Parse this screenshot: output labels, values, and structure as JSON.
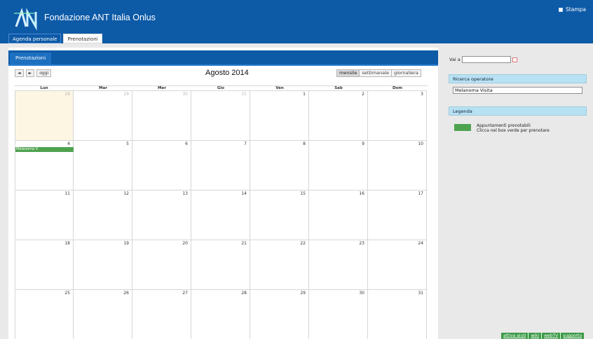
{
  "app": {
    "title": "Fondazione ANT Italia Onlus",
    "print_label": "Stampa",
    "logo_label": "ANT"
  },
  "top_tabs": [
    {
      "label": "Agenda personale"
    },
    {
      "label": "Prenotazioni"
    }
  ],
  "section": {
    "tab_label": "Prenotazioni"
  },
  "calendar": {
    "prev_label": "◄",
    "next_label": "►",
    "today_label": "oggi",
    "month_title": "Agosto 2014",
    "views": [
      "mensile",
      "settimanale",
      "giornaliera"
    ],
    "current_view": "mensile",
    "day_headers": [
      "Lun",
      "Mar",
      "Mer",
      "Gio",
      "Ven",
      "Sab",
      "Dom"
    ],
    "weeks": [
      [
        "28",
        "29",
        "30",
        "31",
        "1",
        "2",
        "3"
      ],
      [
        "4",
        "5",
        "6",
        "7",
        "8",
        "9",
        "10"
      ],
      [
        "11",
        "12",
        "13",
        "14",
        "15",
        "16",
        "17"
      ],
      [
        "18",
        "19",
        "20",
        "21",
        "22",
        "23",
        "24"
      ],
      [
        "25",
        "26",
        "27",
        "28",
        "29",
        "30",
        "31"
      ]
    ],
    "event": {
      "label": "Melanoma V"
    }
  },
  "side": {
    "goto_label": "Vai a",
    "operator_section_title": "Ricerca operatore",
    "operator_value": "Melanoma Visita",
    "legend_title": "Legenda",
    "legend_line1": "Appuntamenti prenotabili",
    "legend_line2": "Clicca nel box verde per prenotare"
  },
  "footer_links": [
    "attiva aiuti",
    "wiki",
    "webTV",
    "supporto"
  ],
  "colors": {
    "header_blue": "#0d5aa7",
    "event_green": "#4fa34f",
    "today_bg": "#fdf6e3"
  }
}
